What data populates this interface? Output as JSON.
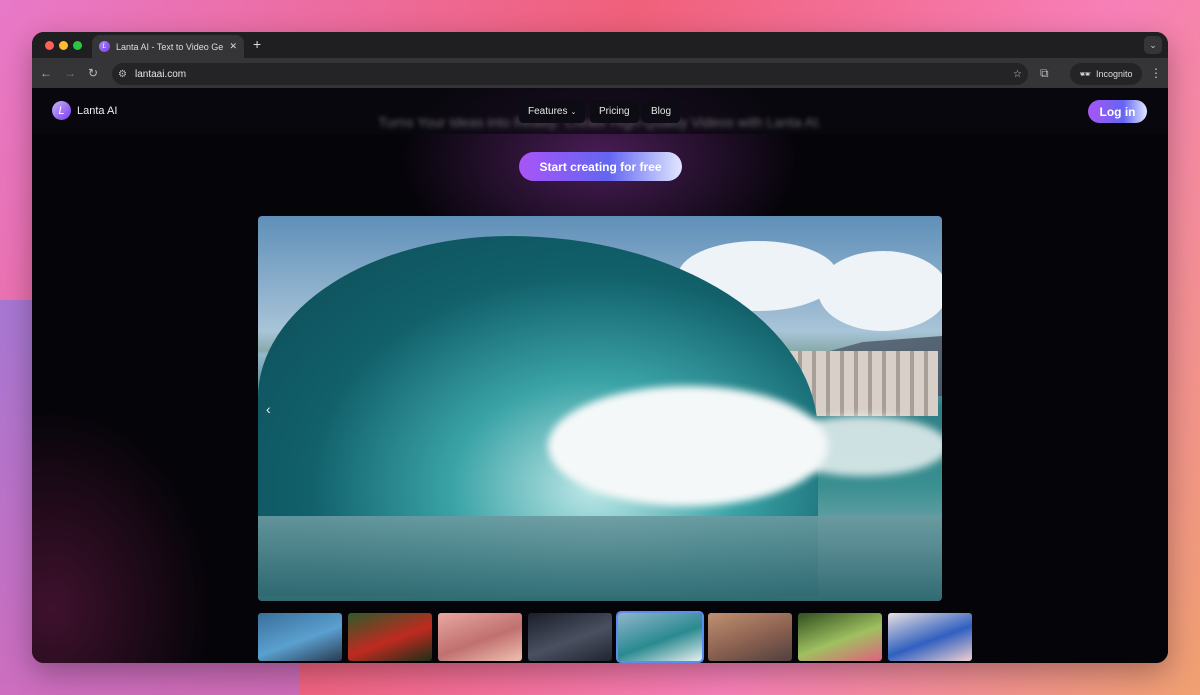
{
  "browser": {
    "tab_title": "Lanta AI - Text to Video Generator",
    "url": "lantaai.com",
    "incognito_label": "Incognito"
  },
  "nav": {
    "brand": "Lanta AI",
    "logo_letter": "L",
    "features": "Features",
    "pricing": "Pricing",
    "blog": "Blog",
    "login": "Log in",
    "hero_heading": "Turns Your Ideas into Reality: Create High-Quality Videos with Lanta AI."
  },
  "cta": "Start creating for free",
  "carousel": {
    "prev": "‹",
    "selected_index": 4,
    "thumbnails": [
      {
        "name": "person-smoke",
        "colors": [
          "#3a6f9a",
          "#5aa0d0",
          "#2a3a50"
        ]
      },
      {
        "name": "parrot",
        "colors": [
          "#2f5a2a",
          "#c02a20",
          "#1a3018"
        ]
      },
      {
        "name": "eye-closeup",
        "colors": [
          "#e8a8a0",
          "#c07070",
          "#f0c0b0"
        ]
      },
      {
        "name": "city-night",
        "colors": [
          "#1a1f2a",
          "#4a5060",
          "#20252f"
        ]
      },
      {
        "name": "ocean-wave",
        "colors": [
          "#8fb5cc",
          "#2a8a90",
          "#e8f0f0"
        ]
      },
      {
        "name": "street-car",
        "colors": [
          "#c09070",
          "#8a6050",
          "#504040"
        ]
      },
      {
        "name": "garden",
        "colors": [
          "#305020",
          "#a0c060",
          "#e06080"
        ]
      },
      {
        "name": "bluebird",
        "colors": [
          "#e8e0e0",
          "#3060c0",
          "#f0d0d0"
        ]
      }
    ]
  }
}
